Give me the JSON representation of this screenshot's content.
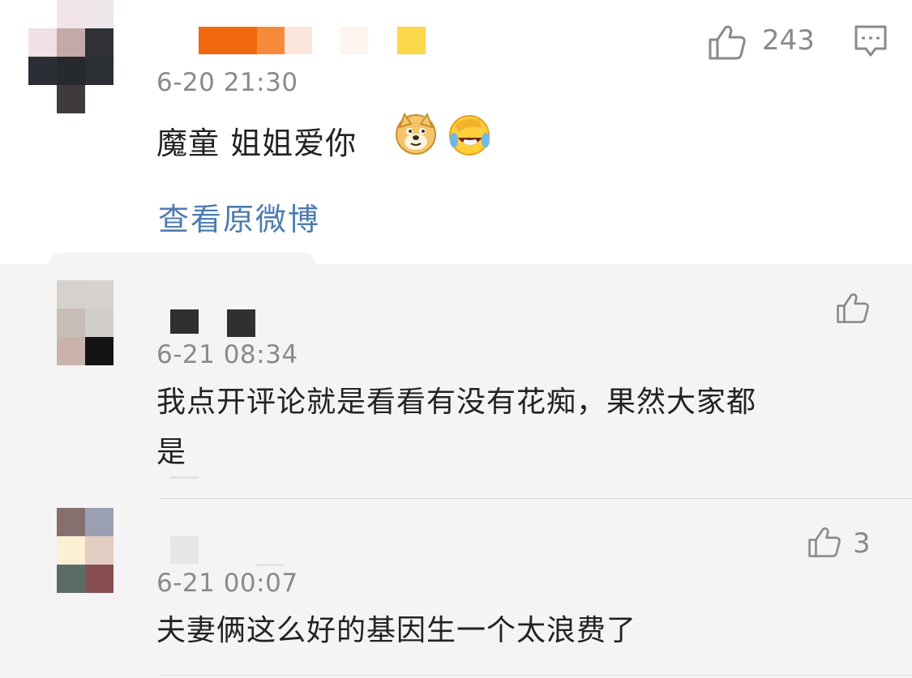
{
  "colors": {
    "link": "#4e7cb0",
    "meta": "#8a8a8a",
    "text": "#222222",
    "comment_bg": "#f4f4f4"
  },
  "post": {
    "time": "6-20 21:30",
    "text": "魔童 姐姐爱你",
    "emoji": [
      "doge-emoji",
      "laughing-crying-emoji"
    ],
    "like_count": "243",
    "view_original": "查看原微博",
    "icons": [
      "thumbs-up-icon",
      "comment-icon"
    ]
  },
  "comments": [
    {
      "time": "6-21 08:34",
      "text_line1": "我点开评论就是看看有没有花痴，果然大家都",
      "text_line2": "是",
      "like_count": ""
    },
    {
      "time": "6-21 00:07",
      "text": "夫妻俩这么好的基因生一个太浪费了",
      "like_count": "3"
    }
  ]
}
